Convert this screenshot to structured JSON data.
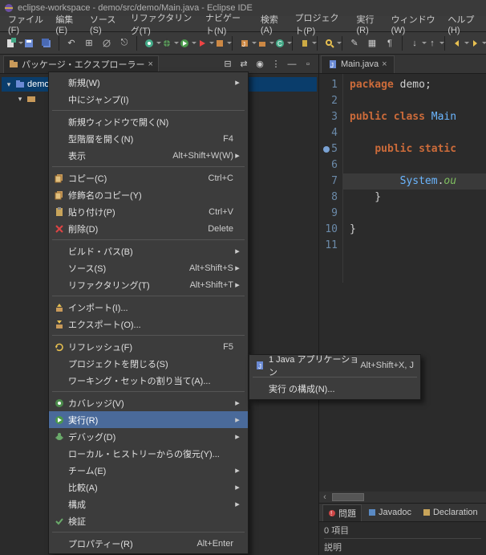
{
  "title": "eclipse-workspace - demo/src/demo/Main.java - Eclipse IDE",
  "menubar": [
    "ファイル(F)",
    "編集(E)",
    "ソース(S)",
    "リファクタリング(T)",
    "ナビゲート(N)",
    "検索(A)",
    "プロジェクト(P)",
    "実行(R)",
    "ウィンドウ(W)",
    "ヘルプ(H)"
  ],
  "explorer": {
    "title": "パッケージ・エクスプローラー",
    "nodes": [
      {
        "label": "demo",
        "expanded": true,
        "selected": true
      },
      {
        "label": "",
        "expanded": true
      }
    ]
  },
  "editor": {
    "tab": "Main.java",
    "lines": [
      {
        "n": 1,
        "tokens": [
          {
            "t": "package ",
            "c": "kw"
          },
          {
            "t": "demo",
            "c": "id"
          },
          {
            "t": ";",
            "c": "punct"
          }
        ]
      },
      {
        "n": 2,
        "tokens": []
      },
      {
        "n": 3,
        "tokens": [
          {
            "t": "public class ",
            "c": "kw"
          },
          {
            "t": "Main",
            "c": "cls"
          }
        ]
      },
      {
        "n": 4,
        "tokens": []
      },
      {
        "n": 5,
        "bp": true,
        "tokens": [
          {
            "t": "    ",
            "c": "id"
          },
          {
            "t": "public static",
            "c": "kw"
          }
        ]
      },
      {
        "n": 6,
        "tokens": []
      },
      {
        "n": 7,
        "hl": true,
        "tokens": [
          {
            "t": "        ",
            "c": "id"
          },
          {
            "t": "System",
            "c": "cls"
          },
          {
            "t": ".",
            "c": "punct"
          },
          {
            "t": "ou",
            "c": "mth"
          }
        ]
      },
      {
        "n": 8,
        "tokens": [
          {
            "t": "    }",
            "c": "punct"
          }
        ]
      },
      {
        "n": 9,
        "tokens": []
      },
      {
        "n": 10,
        "tokens": [
          {
            "t": "}",
            "c": "punct"
          }
        ]
      },
      {
        "n": 11,
        "tokens": []
      }
    ]
  },
  "context_menu": {
    "groups": [
      [
        {
          "label": "新規(W)",
          "sub": true
        },
        {
          "label": "中にジャンプ(I)"
        }
      ],
      [
        {
          "label": "新規ウィンドウで開く(N)"
        },
        {
          "label": "型階層を開く(N)",
          "shortcut": "F4"
        },
        {
          "label": "表示",
          "shortcut": "Alt+Shift+W(W)",
          "sub": true
        }
      ],
      [
        {
          "icon": "copy",
          "label": "コピー(C)",
          "shortcut": "Ctrl+C"
        },
        {
          "icon": "copy",
          "label": "修飾名のコピー(Y)"
        },
        {
          "icon": "paste",
          "label": "貼り付け(P)",
          "shortcut": "Ctrl+V"
        },
        {
          "icon": "delete",
          "label": "削除(D)",
          "shortcut": "Delete"
        }
      ],
      [
        {
          "label": "ビルド・パス(B)",
          "sub": true
        },
        {
          "label": "ソース(S)",
          "shortcut": "Alt+Shift+S",
          "sub": true
        },
        {
          "label": "リファクタリング(T)",
          "shortcut": "Alt+Shift+T",
          "sub": true
        }
      ],
      [
        {
          "icon": "import",
          "label": "インポート(I)..."
        },
        {
          "icon": "export",
          "label": "エクスポート(O)..."
        }
      ],
      [
        {
          "icon": "refresh",
          "label": "リフレッシュ(F)",
          "shortcut": "F5"
        },
        {
          "label": "プロジェクトを閉じる(S)"
        },
        {
          "label": "ワーキング・セットの割り当て(A)..."
        }
      ],
      [
        {
          "icon": "coverage",
          "label": "カバレッジ(V)",
          "sub": true
        },
        {
          "icon": "run",
          "label": "実行(R)",
          "sub": true,
          "selected": true
        },
        {
          "icon": "debug",
          "label": "デバッグ(D)",
          "sub": true
        },
        {
          "label": "ローカル・ヒストリーからの復元(Y)..."
        },
        {
          "label": "チーム(E)",
          "sub": true
        },
        {
          "label": "比較(A)",
          "sub": true
        },
        {
          "label": "構成",
          "sub": true
        },
        {
          "icon": "validate",
          "label": "検証"
        }
      ],
      [
        {
          "label": "プロパティー(R)",
          "shortcut": "Alt+Enter"
        }
      ]
    ]
  },
  "submenu": [
    {
      "icon": "java",
      "label": "1 Java アプリケーション",
      "shortcut": "Alt+Shift+X, J"
    },
    null,
    {
      "label": "実行 の構成(N)..."
    }
  ],
  "problems": {
    "tabs": [
      "問題",
      "Javadoc",
      "Declaration"
    ],
    "count": "0 項目",
    "col": "説明"
  }
}
